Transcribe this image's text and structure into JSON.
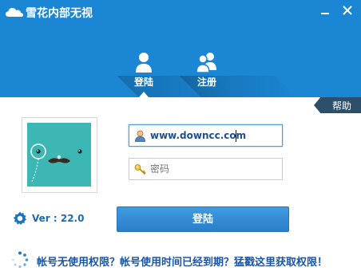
{
  "app": {
    "title": "雪花内部无视"
  },
  "window": {
    "minimize_icon": "minimize-icon",
    "close_icon": "close-icon"
  },
  "tabs": [
    {
      "label": "登陆",
      "icon": "user-icon",
      "active": true
    },
    {
      "label": "注册",
      "icon": "add-user-icon",
      "active": false
    }
  ],
  "help": {
    "label": "帮助"
  },
  "avatar": {
    "icon": "monocle-face-avatar"
  },
  "username": {
    "value": "www.downcc.com",
    "icon": "user-icon"
  },
  "password": {
    "placeholder": "密码",
    "icon": "key-icon"
  },
  "version": {
    "label": "Ver : 22.0",
    "icon": "gear-icon"
  },
  "login_button": {
    "label": "登陆"
  },
  "promo": {
    "text": "帐号无使用权限？帐号使用时间已经到期？猛戳这里获取权限！",
    "icon": "spinner-icon"
  },
  "colors": {
    "header_blue": "#1a86d4",
    "accent": "#2a7fc8",
    "help_tab": "#2c4f6c",
    "avatar_bg": "#3cb7b4"
  }
}
